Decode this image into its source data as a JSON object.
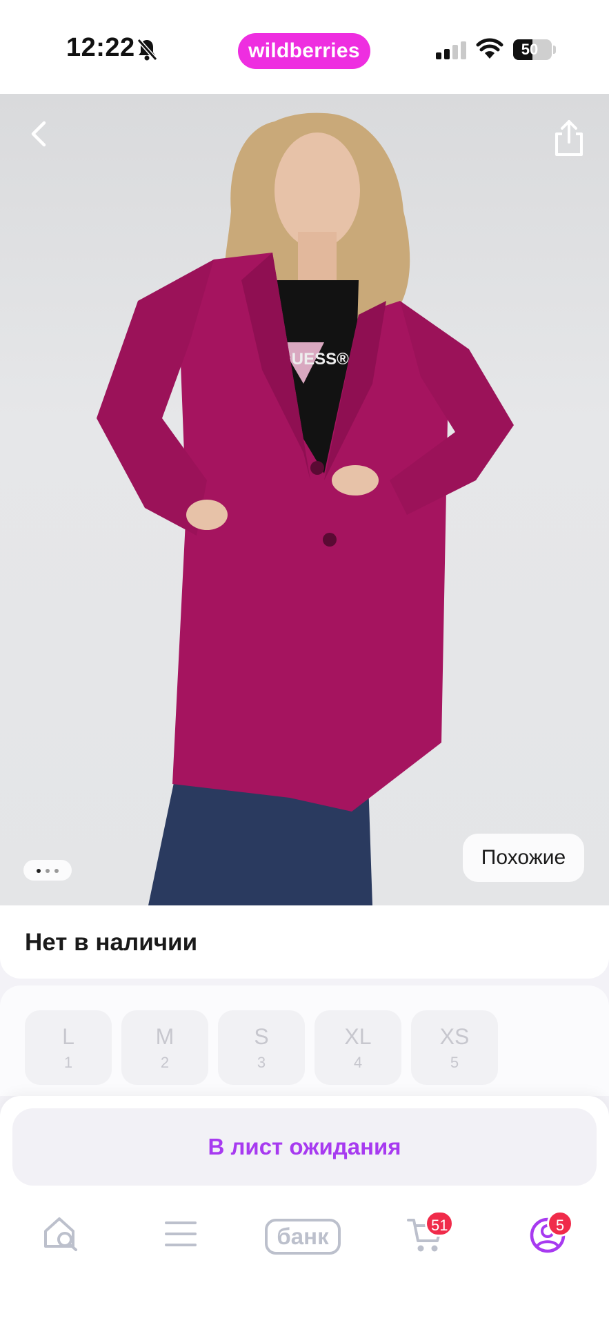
{
  "status_bar": {
    "time": "12:22",
    "app_logo": "wildberries",
    "battery": "50",
    "battery_level": 0.5
  },
  "product": {
    "similar_label": "Похожие",
    "image_index": 1,
    "image_count": 3,
    "availability": "Нет в наличии"
  },
  "sizes": [
    {
      "label": "L",
      "num": "1"
    },
    {
      "label": "M",
      "num": "2"
    },
    {
      "label": "S",
      "num": "3"
    },
    {
      "label": "XL",
      "num": "4"
    },
    {
      "label": "XS",
      "num": "5"
    }
  ],
  "actions": {
    "waitlist_label": "В лист ожидания"
  },
  "nav": {
    "bank_label": "банк",
    "cart_badge": "51",
    "profile_badge": "5"
  },
  "colors": {
    "brand": "#ee2ee0",
    "action_text": "#a73af0",
    "badge": "#f02b4a",
    "coat": "#a5145f"
  },
  "icons": [
    "bell-muted-icon",
    "signal-icon",
    "wifi-icon",
    "battery-icon",
    "back-icon",
    "share-icon",
    "home-search-icon",
    "menu-icon",
    "cart-icon",
    "profile-icon"
  ]
}
